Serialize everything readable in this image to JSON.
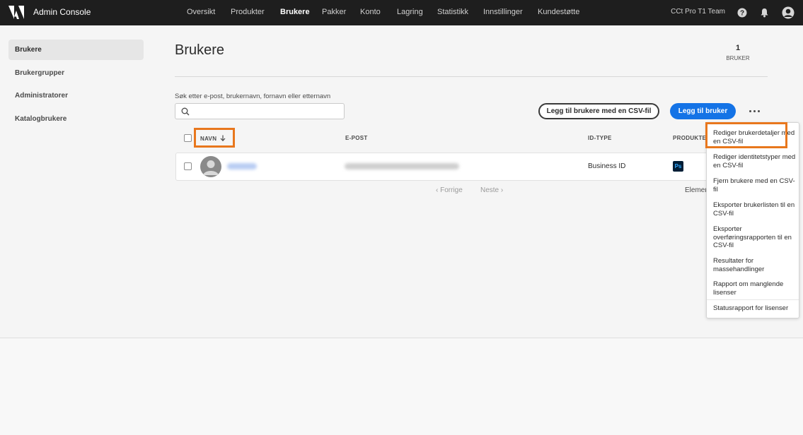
{
  "app": {
    "title": "Admin Console"
  },
  "nav": {
    "items": [
      "Oversikt",
      "Produkter",
      "Brukere",
      "Pakker",
      "Konto",
      "Lagring",
      "Statistikk",
      "Innstillinger",
      "Kundestøtte"
    ],
    "active": "Brukere"
  },
  "header": {
    "org_name": "CCt Pro T1 Team"
  },
  "sidebar": {
    "items": [
      {
        "label": "Brukere",
        "active": true
      },
      {
        "label": "Brukergrupper",
        "active": false
      },
      {
        "label": "Administratorer",
        "active": false
      },
      {
        "label": "Katalogbrukere",
        "active": false
      }
    ]
  },
  "main": {
    "title": "Brukere",
    "count": "1",
    "count_label": "BRUKER",
    "search": {
      "label": "Søk etter e-post, brukernavn, fornavn eller etternavn",
      "value": "",
      "placeholder": ""
    },
    "add_csv_button": "Legg til brukere med en CSV-fil",
    "add_user_button": "Legg til bruker"
  },
  "table": {
    "columns": {
      "name": "NAVN",
      "email": "E-POST",
      "id_type": "ID-TYPE",
      "products": "PRODUKTER"
    },
    "rows": [
      {
        "id_type": "Business ID",
        "product_icon": "Ps"
      }
    ]
  },
  "pager": {
    "prev": "Forrige",
    "next": "Neste",
    "elements": "Elemen"
  },
  "menu": {
    "items": [
      "Rediger brukerdetaljer med en CSV-fil",
      "Rediger identitetstyper med en CSV-fil",
      "Fjern brukere med en CSV-fil",
      "Eksporter brukerlisten til en CSV-fil",
      "Eksporter overføringsrapporten til en CSV-fil",
      "Resultater for massehandlinger",
      "Rapport om manglende lisenser",
      "Statusrapport for lisenser"
    ]
  },
  "colors": {
    "accent": "#1473e6",
    "highlight": "#e8771d",
    "topbar": "#1e1e1e"
  }
}
